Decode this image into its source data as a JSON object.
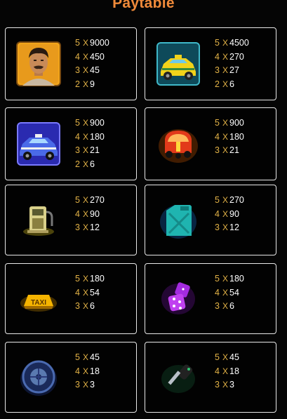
{
  "title": "Paytable",
  "symbols": [
    {
      "icon": "man-portrait-icon",
      "pays": [
        [
          "5",
          "X",
          "9000"
        ],
        [
          "4",
          "X",
          "450"
        ],
        [
          "3",
          "X",
          "45"
        ],
        [
          "2",
          "X",
          "9"
        ]
      ]
    },
    {
      "icon": "yellow-taxi-car-icon",
      "pays": [
        [
          "5",
          "X",
          "4500"
        ],
        [
          "4",
          "X",
          "270"
        ],
        [
          "3",
          "X",
          "27"
        ],
        [
          "2",
          "X",
          "6"
        ]
      ]
    },
    {
      "icon": "blue-taxi-car-icon",
      "pays": [
        [
          "5",
          "X",
          "900"
        ],
        [
          "4",
          "X",
          "180"
        ],
        [
          "3",
          "X",
          "21"
        ],
        [
          "2",
          "X",
          "6"
        ]
      ]
    },
    {
      "icon": "auto-rickshaw-icon",
      "pays": [
        [
          "5",
          "X",
          "900"
        ],
        [
          "4",
          "X",
          "180"
        ],
        [
          "3",
          "X",
          "21"
        ]
      ]
    },
    {
      "icon": "gas-pump-icon",
      "pays": [
        [
          "5",
          "X",
          "270"
        ],
        [
          "4",
          "X",
          "90"
        ],
        [
          "3",
          "X",
          "12"
        ]
      ]
    },
    {
      "icon": "jerry-can-icon",
      "pays": [
        [
          "5",
          "X",
          "270"
        ],
        [
          "4",
          "X",
          "90"
        ],
        [
          "3",
          "X",
          "12"
        ]
      ]
    },
    {
      "icon": "taxi-sign-icon",
      "sign_text": "TAXI",
      "pays": [
        [
          "5",
          "X",
          "180"
        ],
        [
          "4",
          "X",
          "54"
        ],
        [
          "3",
          "X",
          "6"
        ]
      ]
    },
    {
      "icon": "dice-icon",
      "pays": [
        [
          "5",
          "X",
          "180"
        ],
        [
          "4",
          "X",
          "54"
        ],
        [
          "3",
          "X",
          "6"
        ]
      ]
    },
    {
      "icon": "tire-icon",
      "pays": [
        [
          "5",
          "X",
          "45"
        ],
        [
          "4",
          "X",
          "18"
        ],
        [
          "3",
          "X",
          "3"
        ]
      ]
    },
    {
      "icon": "car-key-icon",
      "pays": [
        [
          "5",
          "X",
          "45"
        ],
        [
          "4",
          "X",
          "18"
        ],
        [
          "3",
          "X",
          "3"
        ]
      ]
    }
  ]
}
